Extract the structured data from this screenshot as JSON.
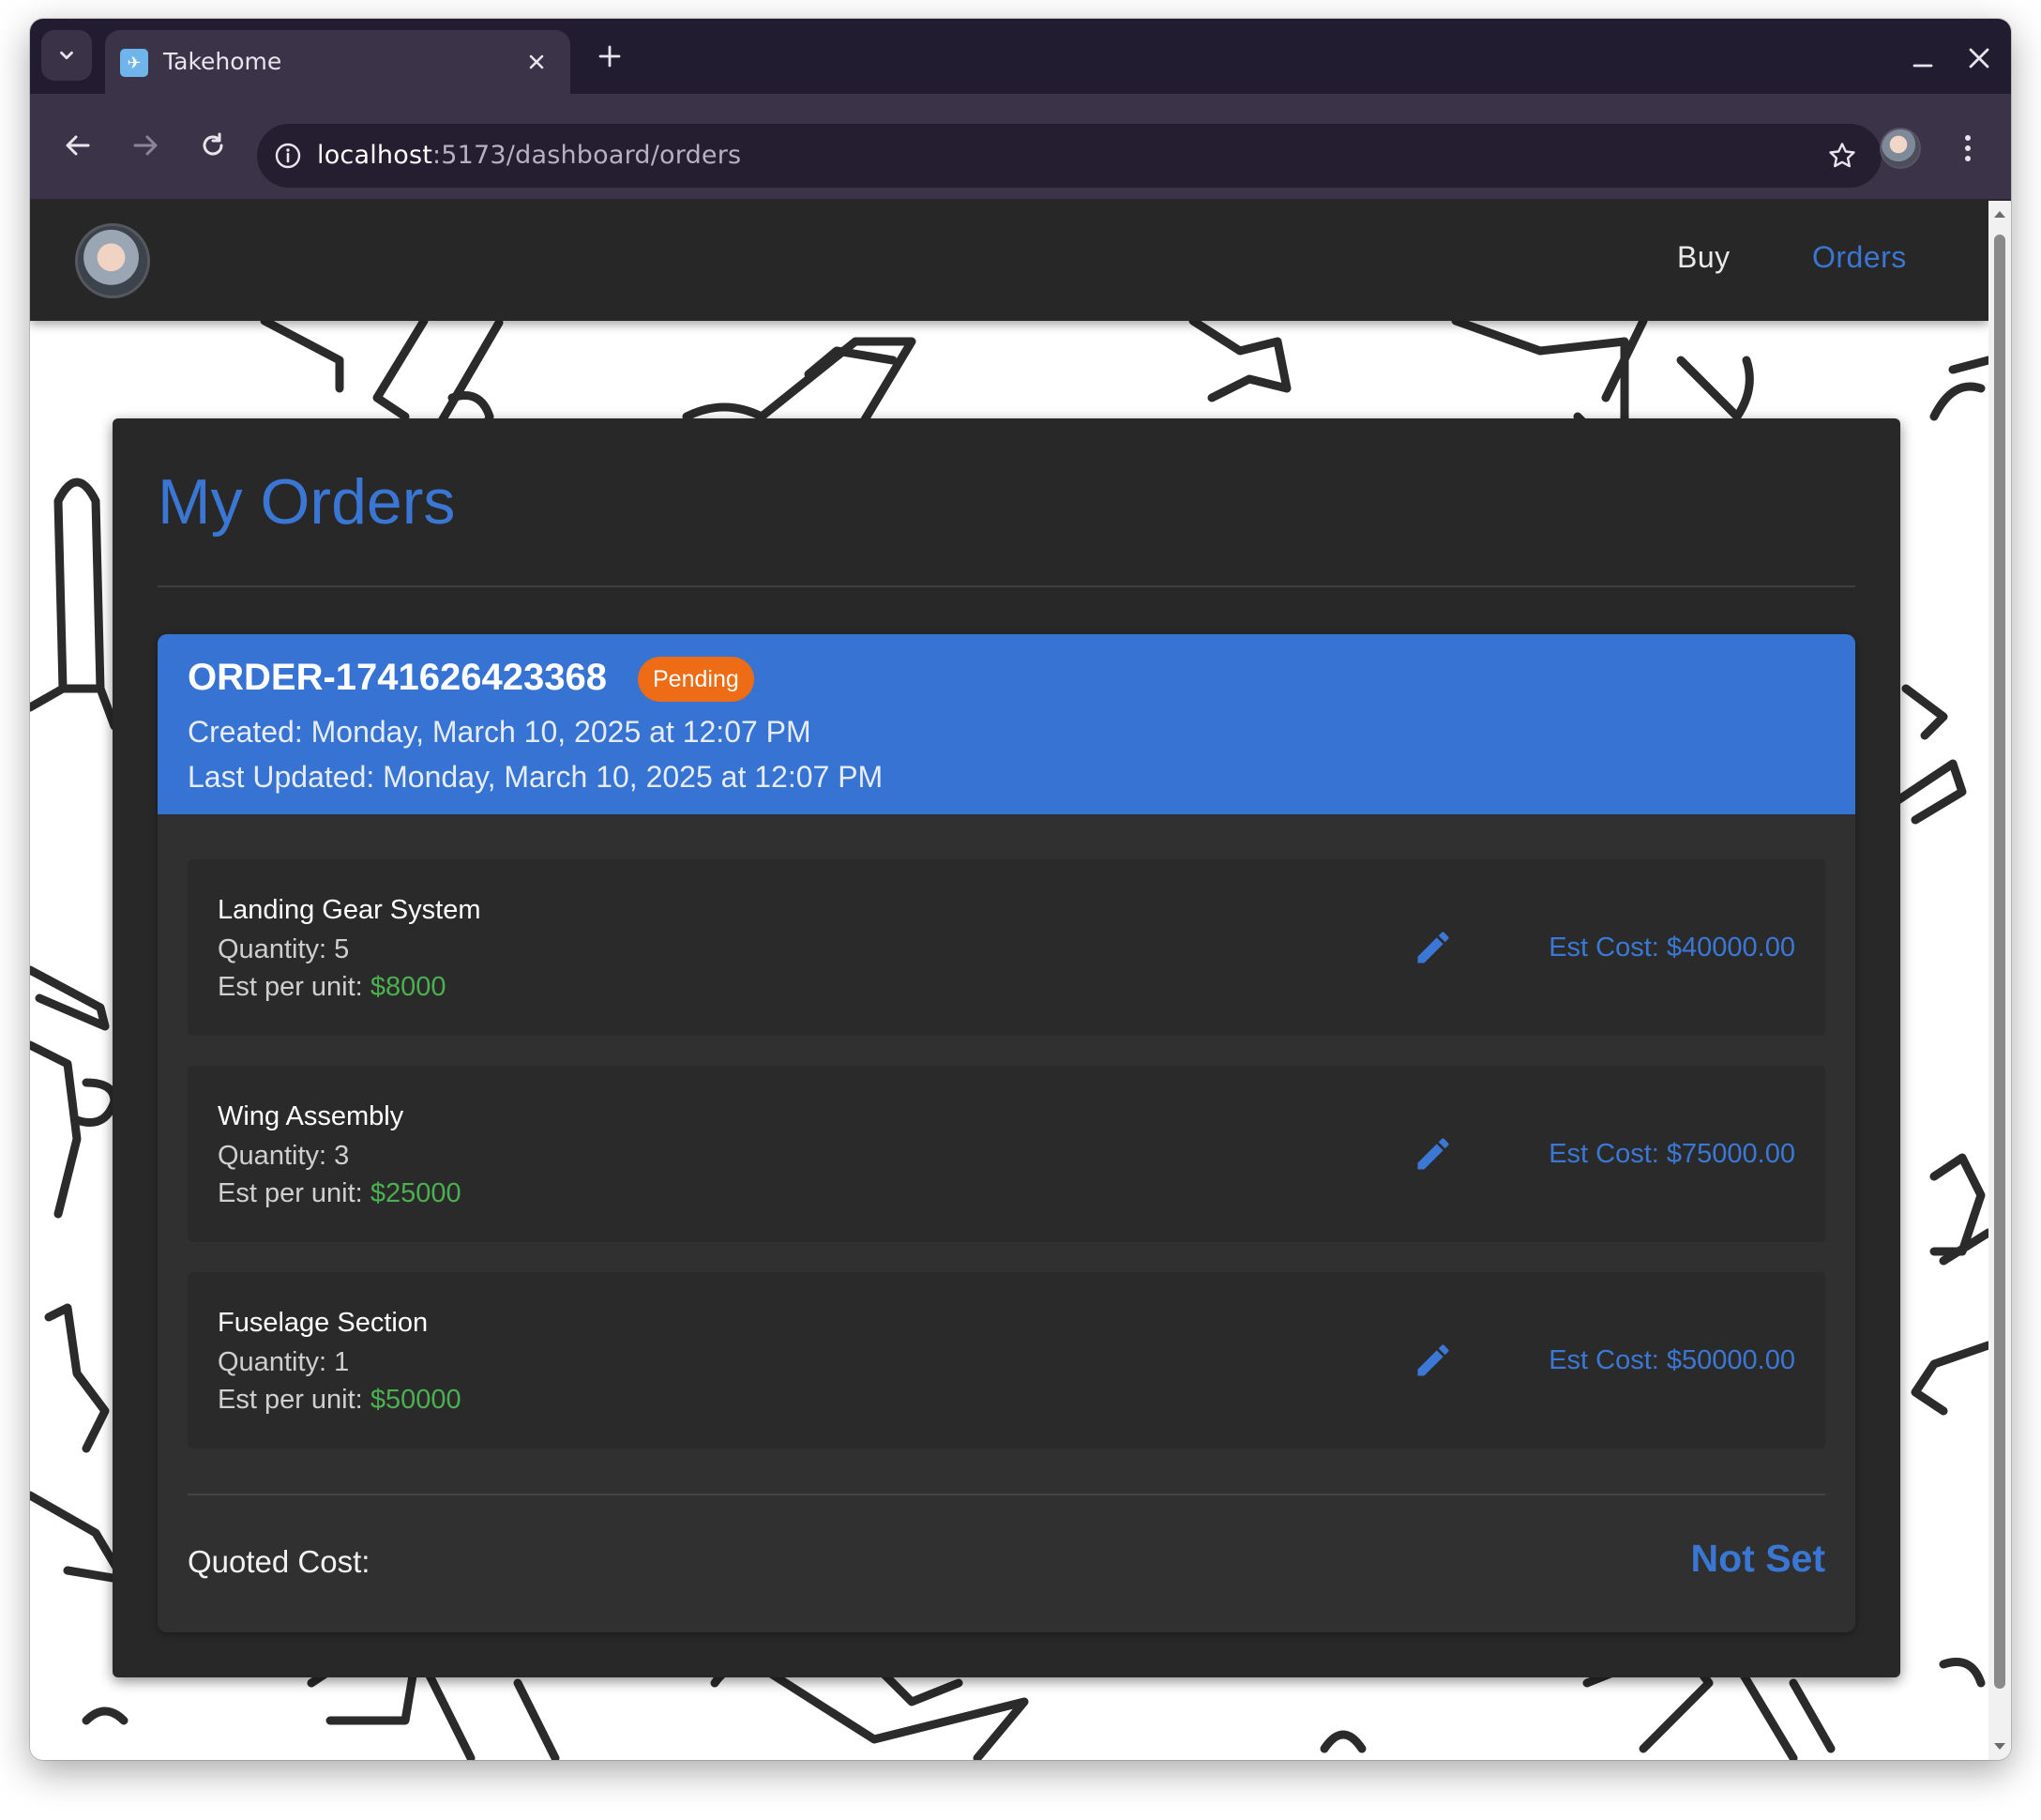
{
  "browser": {
    "tab_title": "Takehome",
    "url_host": "localhost",
    "url_rest": ":5173/dashboard/orders",
    "icons": {
      "tab_search": "chevron-down-icon",
      "tab_favicon": "airplane-icon",
      "tab_close": "close-icon",
      "new_tab": "plus-icon",
      "back": "arrow-left-icon",
      "forward": "arrow-right-icon",
      "reload": "reload-icon",
      "site_info": "info-icon",
      "bookmark": "star-icon",
      "menu": "more-vertical-icon"
    }
  },
  "app": {
    "nav": {
      "buy": "Buy",
      "orders": "Orders",
      "active": "Orders"
    },
    "colors": {
      "accent": "#3a77d4",
      "header_bg": "#3773d2",
      "pending": "#ed6c15",
      "price_green": "#4bb04f",
      "surface": "#282828"
    }
  },
  "page": {
    "title": "My Orders"
  },
  "order": {
    "id": "ORDER-1741626423368",
    "status": "Pending",
    "created": "Created: Monday, March 10, 2025 at 12:07 PM",
    "updated": "Last Updated: Monday, March 10, 2025 at 12:07 PM",
    "unit_label": "Est per unit: ",
    "items": [
      {
        "name": "Landing Gear System",
        "quantity": "Quantity: 5",
        "unit_price": "$8000",
        "est_cost": "Est Cost: $40000.00"
      },
      {
        "name": "Wing Assembly",
        "quantity": "Quantity: 3",
        "unit_price": "$25000",
        "est_cost": "Est Cost: $75000.00"
      },
      {
        "name": "Fuselage Section",
        "quantity": "Quantity: 1",
        "unit_price": "$50000",
        "est_cost": "Est Cost: $50000.00"
      }
    ],
    "quoted_label": "Quoted Cost:",
    "quoted_value": "Not Set"
  }
}
